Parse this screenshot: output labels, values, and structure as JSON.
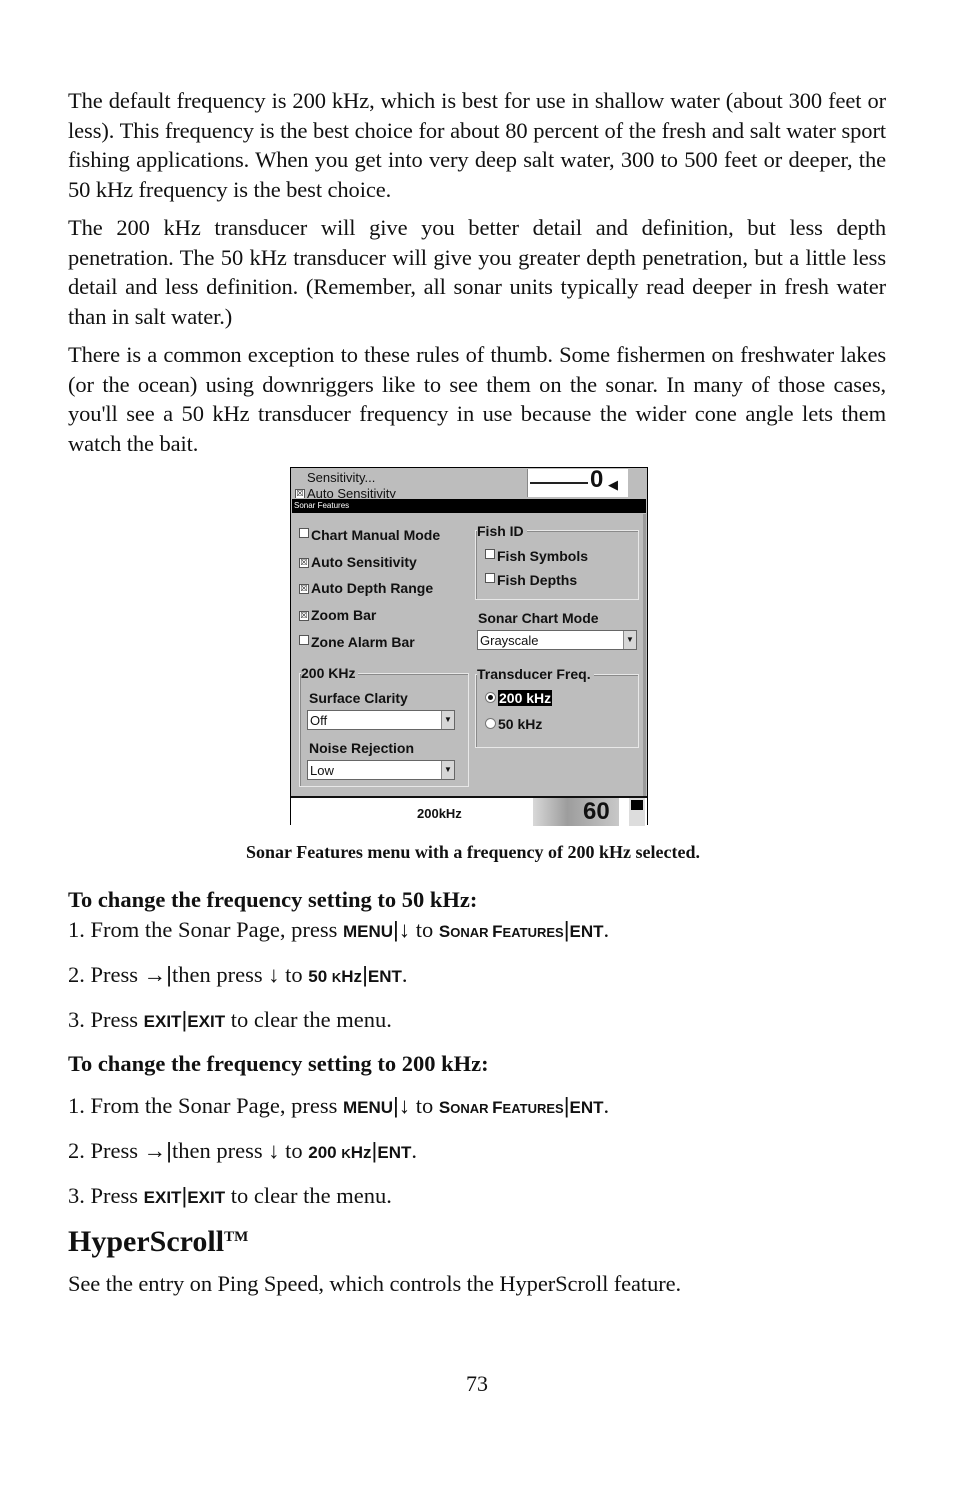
{
  "intro_paragraphs": [
    "The default frequency is 200 kHz, which is best for use in shallow water (about 300 feet or less). This frequency is the best choice for about 80 percent of the fresh and salt water sport fishing applications. When you get into very deep salt water, 300 to 500 feet or deeper, the 50 kHz frequency is the best choice.",
    "The 200 kHz transducer will give you better detail and definition, but less depth penetration. The 50 kHz transducer will give you greater depth penetration, but a little less detail and less definition. (Remember, all sonar units typically read deeper in fresh water than in salt water.)",
    "There is a common exception to these rules of thumb. Some fishermen on freshwater lakes (or the ocean) using downriggers like to see them on the sonar. In many of those cases, you'll see a 50 kHz transducer frequency in use because the wider cone angle lets them watch the bait."
  ],
  "screenshot": {
    "behind_menu": {
      "sensitivity": "Sensitivity...",
      "auto_sensitivity": "Auto Sensitivity",
      "gauge_value": "0"
    },
    "title": "Sonar Features",
    "checkboxes": [
      {
        "label": "Chart Manual Mode",
        "checked": false
      },
      {
        "label": "Auto Sensitivity",
        "checked": true
      },
      {
        "label": "Auto Depth Range",
        "checked": true
      },
      {
        "label": "Zoom Bar",
        "checked": true
      },
      {
        "label": "Zone Alarm Bar",
        "checked": false
      }
    ],
    "fish_id": {
      "label": "Fish ID",
      "items": [
        {
          "label": "Fish Symbols",
          "checked": false
        },
        {
          "label": "Fish Depths",
          "checked": false
        }
      ]
    },
    "sonar_chart_mode": {
      "label": "Sonar Chart Mode",
      "value": "Grayscale"
    },
    "khz_group": {
      "label": "200 KHz",
      "surface_clarity": {
        "label": "Surface Clarity",
        "value": "Off"
      },
      "noise_rejection": {
        "label": "Noise Rejection",
        "value": "Low"
      }
    },
    "transducer_freq": {
      "label": "Transducer Freq.",
      "options": [
        {
          "label": "200 kHz",
          "selected": true
        },
        {
          "label": "50 kHz",
          "selected": false
        }
      ]
    },
    "status": {
      "frequency": "200kHz",
      "depth": "60"
    },
    "check_mark": "☒",
    "dropdown_arrow": "▼"
  },
  "caption": "Sonar Features menu with a frequency of 200 kHz selected.",
  "section_50": {
    "heading": "To change the frequency setting to 50 kHz:",
    "step1": {
      "num": "1. From the Sonar Page, press ",
      "k1": "MENU",
      "sep": "|",
      "arrow": "↓",
      "to": " to ",
      "k2a": "S",
      "k2b": "ONAR ",
      "k2c": "F",
      "k2d": "EATURES",
      "k3": "ENT",
      "end": "."
    },
    "step2": {
      "num": "2. Press ",
      "arrow1": "→",
      "sep": "|",
      "mid": "then press ",
      "arrow2": "↓",
      "to": " to ",
      "k1a": "50 ",
      "k1b": "K",
      "k1c": "Hz",
      "k2": "ENT",
      "end": "."
    },
    "step3": {
      "num": "3. Press ",
      "k1": "EXIT",
      "sep": "|",
      "k2": "EXIT",
      "end": " to clear the menu."
    }
  },
  "section_200": {
    "heading": "To change the frequency setting to 200 kHz:",
    "step1": {
      "num": "1. From the Sonar Page, press ",
      "k1": "MENU",
      "sep": "|",
      "arrow": "↓",
      "to": " to ",
      "k2a": "S",
      "k2b": "ONAR ",
      "k2c": "F",
      "k2d": "EATURES",
      "k3": "ENT",
      "end": "."
    },
    "step2": {
      "num": "2. Press ",
      "arrow1": "→",
      "sep": "|",
      "mid": "then press ",
      "arrow2": "↓",
      "to": " to ",
      "k1a": "200 ",
      "k1b": "K",
      "k1c": "Hz",
      "k2": "ENT",
      "end": "."
    },
    "step3": {
      "num": "3. Press ",
      "k1": "EXIT",
      "sep": "|",
      "k2": "EXIT",
      "end": " to clear the menu."
    }
  },
  "hyperscroll": {
    "heading": "HyperScroll",
    "tm": "TM",
    "body": "See the entry on Ping Speed, which controls the HyperScroll feature."
  },
  "page_number": "73"
}
